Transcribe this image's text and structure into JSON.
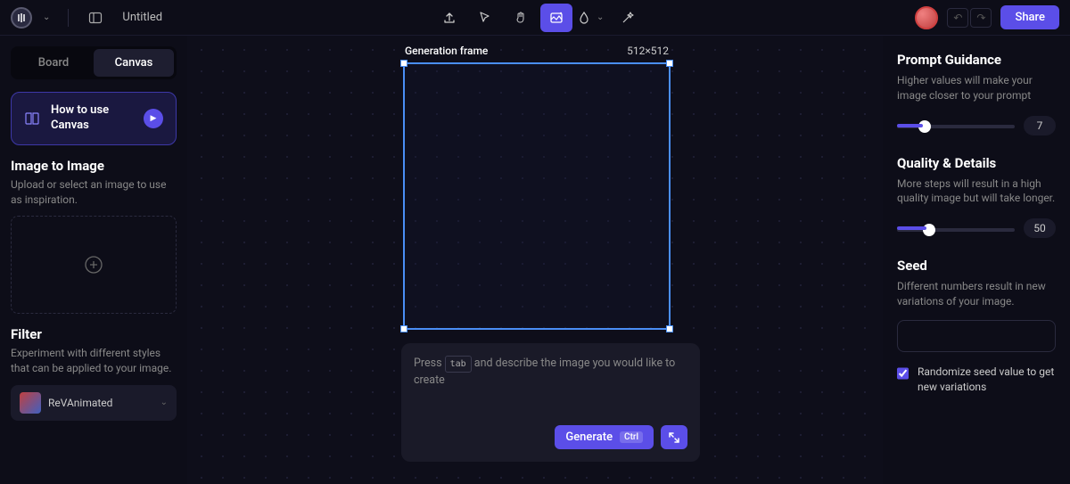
{
  "topbar": {
    "title": "Untitled",
    "share_label": "Share"
  },
  "left": {
    "tabs": {
      "board": "Board",
      "canvas": "Canvas"
    },
    "howto": {
      "text": "How to use Canvas"
    },
    "image_to_image": {
      "title": "Image to Image",
      "desc": "Upload or select an image to use as inspiration."
    },
    "filter": {
      "title": "Filter",
      "desc": "Experiment with different styles that can be applied to your image.",
      "selected": "ReVAnimated"
    }
  },
  "canvas": {
    "frame_label": "Generation frame",
    "frame_dims": "512×512",
    "prompt_pre": "Press ",
    "prompt_kbd": "tab",
    "prompt_post": " and describe the image you would like to create",
    "generate_label": "Generate",
    "generate_kbd": "Ctrl"
  },
  "right": {
    "guidance": {
      "title": "Prompt Guidance",
      "desc": "Higher values will make your image closer to your prompt",
      "value": "7"
    },
    "quality": {
      "title": "Quality & Details",
      "desc": "More steps will result in a high quality image but will take longer.",
      "value": "50"
    },
    "seed": {
      "title": "Seed",
      "desc": "Different numbers result in new variations of your image.",
      "randomize_label": "Randomize seed value to get new variations"
    }
  }
}
